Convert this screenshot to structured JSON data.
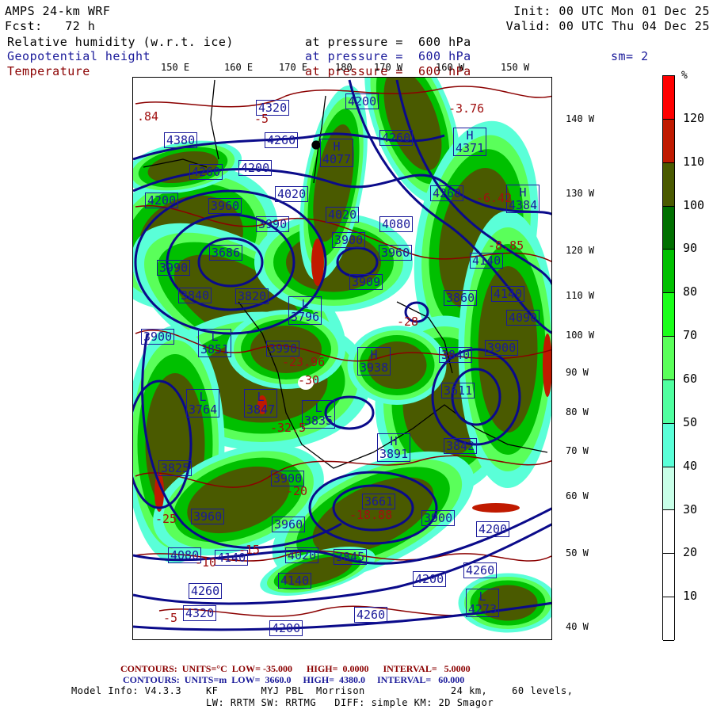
{
  "header": {
    "model": "AMPS 24-km WRF",
    "forecast": "Fcst:   72 h",
    "init": "Init: 00 UTC Mon 01 Dec 25",
    "valid": "Valid: 00 UTC Thu 04 Dec 25",
    "field1": "Relative humidity (w.r.t. ice)",
    "field1_level": "at pressure =  600 hPa",
    "field2": "Geopotential height",
    "field2_level": "at pressure =  600 hPa",
    "smoothing": "sm= 2",
    "field3": "Temperature",
    "field3_level": "at pressure =  600 hPa"
  },
  "colors": {
    "humidity_title": "#000000",
    "height": "#1a1a9a",
    "temperature": "#8b0000"
  },
  "longitude_labels": [
    "150 E",
    "160 E",
    "170 E",
    "180",
    "170 W",
    "160 W",
    "150 W"
  ],
  "right_labels": [
    "140 W",
    "130 W",
    "120 W",
    "110 W",
    "100 W",
    "90 W",
    "80 W",
    "70 W",
    "60 W",
    "50 W",
    "40 W"
  ],
  "colorbar": {
    "unit": "%",
    "ticks": [
      "120",
      "110",
      "100",
      "90",
      "80",
      "70",
      "60",
      "50",
      "40",
      "30",
      "20",
      "10"
    ],
    "colors": [
      "#ff0000",
      "#c01a00",
      "#4a5a00",
      "#007000",
      "#00c000",
      "#1aff1a",
      "#5aff5a",
      "#50ffa0",
      "#5affd8",
      "#c8ffe8",
      "#ffffff",
      "#ffffff",
      "#ffffff"
    ]
  },
  "height_labels": [
    {
      "text": "4320"
    },
    {
      "text": "4200"
    },
    {
      "text": "4380"
    },
    {
      "text": "4260"
    },
    {
      "text": "4260"
    },
    {
      "text": "4200"
    },
    {
      "mark": "H",
      "text": "4077"
    },
    {
      "text": "4260"
    },
    {
      "mark": "H",
      "text": "4371"
    },
    {
      "text": "4200"
    },
    {
      "text": "3960"
    },
    {
      "text": "4020"
    },
    {
      "text": "4260"
    },
    {
      "mark": "H",
      "text": "4384"
    },
    {
      "text": "4020"
    },
    {
      "text": "4080"
    },
    {
      "text": "3990"
    },
    {
      "text": "3900"
    },
    {
      "text": "3960"
    },
    {
      "text": "4140"
    },
    {
      "text": "3990"
    },
    {
      "text": "3686"
    },
    {
      "text": "3840"
    },
    {
      "text": "3820"
    },
    {
      "mark": "L",
      "text": "3796"
    },
    {
      "text": "3909"
    },
    {
      "text": "3860"
    },
    {
      "text": "4140"
    },
    {
      "text": "4090"
    },
    {
      "text": "3900"
    },
    {
      "mark": "L",
      "text": "3851"
    },
    {
      "text": "3990"
    },
    {
      "mark": "H",
      "text": "3938"
    },
    {
      "text": "3840"
    },
    {
      "text": "3900"
    },
    {
      "mark": "L",
      "text": "3764"
    },
    {
      "mark": "L",
      "text": "3847"
    },
    {
      "mark": "L",
      "text": "3835"
    },
    {
      "mark": "H",
      "text": "3891"
    },
    {
      "text": "3611"
    },
    {
      "text": "3842"
    },
    {
      "text": "3825"
    },
    {
      "text": "3900"
    },
    {
      "text": "3960"
    },
    {
      "text": "3960"
    },
    {
      "text": "3661"
    },
    {
      "text": "3900"
    },
    {
      "text": "4200"
    },
    {
      "text": "4080"
    },
    {
      "text": "4140"
    },
    {
      "text": "4020"
    },
    {
      "text": "3845"
    },
    {
      "text": "4140"
    },
    {
      "text": "4260"
    },
    {
      "text": "4200"
    },
    {
      "text": "4260"
    },
    {
      "mark": "L",
      "text": "4273"
    },
    {
      "text": "4320"
    },
    {
      "text": "4200"
    },
    {
      "text": "4260"
    }
  ],
  "temperature_labels": [
    ".84",
    "-5",
    "-3.76",
    "-6.42",
    "-8.85",
    "-28",
    "-23.96",
    "-30",
    "-32.5",
    "-20",
    "-25",
    "-15",
    "-10",
    "-5",
    "-18.88"
  ],
  "footer": {
    "temp_contours": "CONTOURS:  UNITS=°C  LOW= -35.000      HIGH=  0.0000      INTERVAL=   5.0000",
    "height_contours": "CONTOURS:  UNITS=m  LOW=  3660.0     HIGH=  4380.0     INTERVAL=   60.000",
    "model_info": "Model Info: V4.3.3    KF       MYJ PBL  Morrison              24 km,    60 levels,",
    "physics": "LW: RRTM SW: RRTMG   DIFF: simple KM: 2D Smagor"
  }
}
